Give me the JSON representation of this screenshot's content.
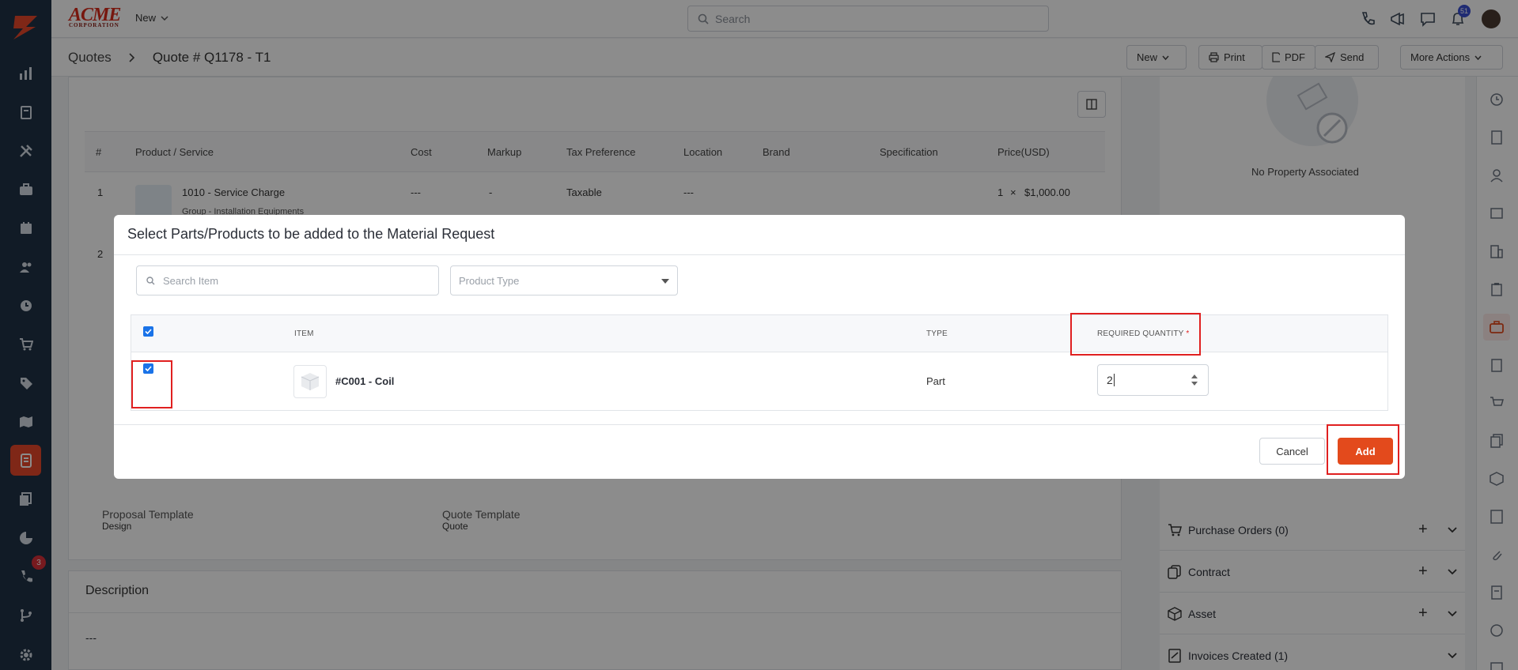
{
  "topbar": {
    "brand": "ACME",
    "brand_sub": "CORPORATION",
    "new_label": "New",
    "search_placeholder": "Search",
    "notification_count": "51"
  },
  "subheader": {
    "breadcrumb": [
      "Quotes",
      "Quote # Q1178 - T1"
    ],
    "buttons": {
      "new": "New",
      "print": "Print",
      "pdf": "PDF",
      "send": "Send",
      "more": "More Actions"
    }
  },
  "leftnav": {
    "badge": "3"
  },
  "quote_table": {
    "headers": [
      "#",
      "Product / Service",
      "Cost",
      "Markup",
      "Tax Preference",
      "Location",
      "Brand",
      "Specification",
      "Price(USD)"
    ],
    "rows": [
      {
        "num": "1",
        "name": "1010 - Service Charge",
        "group": "Group - Installation Equipments",
        "cost": "---",
        "markup": "-",
        "tax": "Taxable",
        "location": "---",
        "qty": "1",
        "times": "×",
        "price": "$1,000.00"
      },
      {
        "num": "2"
      }
    ]
  },
  "templates": {
    "proposal_label": "Proposal Template",
    "proposal_value": "Design",
    "quote_label": "Quote Template",
    "quote_value": "Quote"
  },
  "description": {
    "title": "Description",
    "value": "---"
  },
  "right_panel": {
    "no_property": "No Property Associated",
    "sections": [
      "Purchase Orders (0)",
      "Contract",
      "Asset",
      "Invoices Created (1)"
    ]
  },
  "modal": {
    "title": "Select Parts/Products to be added to the Material Request",
    "search_placeholder": "Search Item",
    "product_type_placeholder": "Product Type",
    "columns": {
      "item": "ITEM",
      "type": "TYPE",
      "required_quantity": "REQUIRED QUANTITY",
      "required_mark": "*"
    },
    "rows": [
      {
        "item": "#C001 - Coil",
        "type": "Part",
        "quantity": "2",
        "checked": true
      }
    ],
    "cancel": "Cancel",
    "add": "Add"
  },
  "colors": {
    "accent": "#e34a1c",
    "nav_bg": "#1f3245",
    "highlight": "#e02020",
    "checkbox": "#1a73e8"
  }
}
